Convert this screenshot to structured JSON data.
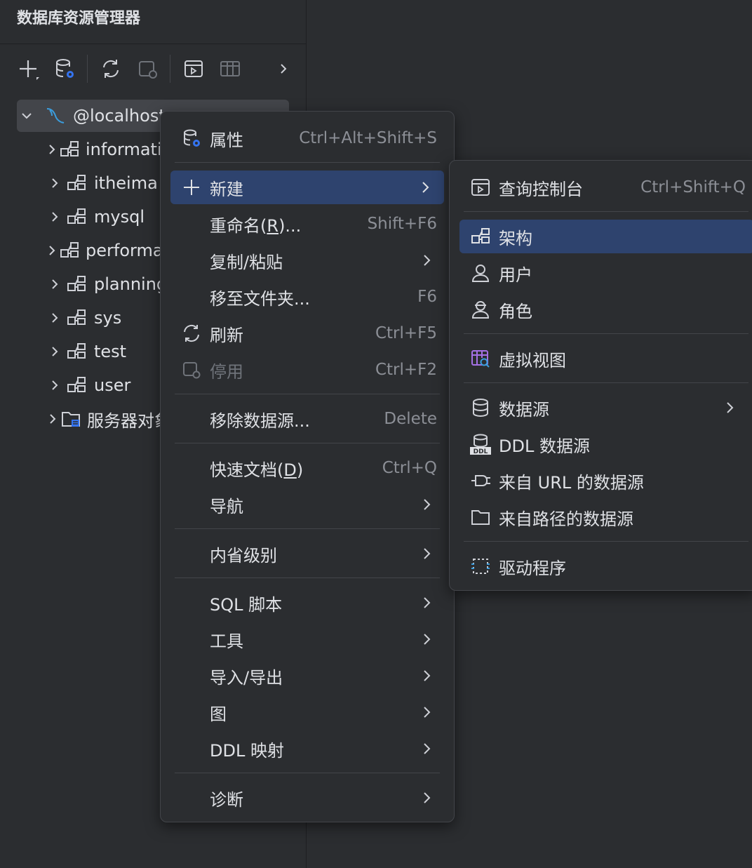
{
  "panel": {
    "title": "数据库资源管理器"
  },
  "tree": {
    "root": "@localhost",
    "items": [
      "information_schema",
      "itheima",
      "mysql",
      "performance_schema",
      "planning",
      "sys",
      "test",
      "user"
    ],
    "server_objects": "服务器对象"
  },
  "context_menu": {
    "properties": {
      "label": "属性",
      "shortcut": "Ctrl+Alt+Shift+S"
    },
    "new": {
      "label": "新建"
    },
    "rename": {
      "label_pre": "重命名(",
      "label_key": "R",
      "label_post": ")...",
      "shortcut": "Shift+F6"
    },
    "copy_paste": {
      "label": "复制/粘贴"
    },
    "move_folder": {
      "label": "移至文件夹...",
      "shortcut": "F6"
    },
    "refresh": {
      "label": "刷新",
      "shortcut": "Ctrl+F5"
    },
    "disable": {
      "label": "停用",
      "shortcut": "Ctrl+F2"
    },
    "remove_source": {
      "label": "移除数据源...",
      "shortcut": "Delete"
    },
    "quick_doc": {
      "label_pre": "快速文档(",
      "label_key": "D",
      "label_post": ")",
      "shortcut": "Ctrl+Q"
    },
    "navigate": {
      "label": "导航"
    },
    "introspection": {
      "label": "内省级别"
    },
    "sql_script": {
      "label": "SQL 脚本"
    },
    "tools": {
      "label": "工具"
    },
    "import_export": {
      "label": "导入/导出"
    },
    "diagram": {
      "label": "图"
    },
    "ddl_mapping": {
      "label": "DDL 映射"
    },
    "diagnostics": {
      "label": "诊断"
    }
  },
  "submenu": {
    "query_console": {
      "label": "查询控制台",
      "shortcut": "Ctrl+Shift+Q"
    },
    "schema": {
      "label": "架构"
    },
    "user": {
      "label": "用户"
    },
    "role": {
      "label": "角色"
    },
    "virtual_view": {
      "label": "虚拟视图"
    },
    "data_source": {
      "label": "数据源"
    },
    "ddl_data_source": {
      "label": "DDL 数据源"
    },
    "url_data_source": {
      "label": "来自 URL 的数据源"
    },
    "path_data_source": {
      "label": "来自路径的数据源"
    },
    "driver": {
      "label": "驱动程序"
    }
  },
  "colors": {
    "highlight": "#2e436e",
    "background": "#2b2d30",
    "accent": "#3574f0"
  }
}
